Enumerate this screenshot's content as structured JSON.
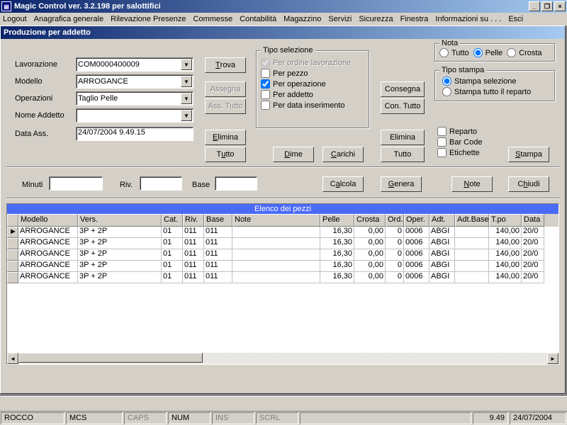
{
  "titlebar": {
    "title": "Magic Control ver. 3.2.198 per salottifici"
  },
  "win_buttons": {
    "min": "_",
    "max": "❐",
    "close": "×"
  },
  "menu": [
    "Logout",
    "Anagrafica generale",
    "Rilevazione Presenze",
    "Commesse",
    "Contabilità",
    "Magazzino",
    "Servizi",
    "Sicurezza",
    "Finestra",
    "Informazioni su . . .",
    "Esci"
  ],
  "child": {
    "title": "Produzione per addetto"
  },
  "labels": {
    "lavorazione": "Lavorazione",
    "modello": "Modello",
    "operazioni": "Operazioni",
    "nome_addetto": "Nome Addetto",
    "data_ass": "Data Ass.",
    "minuti": "Minuti",
    "riv": "Riv.",
    "base": "Base"
  },
  "fields": {
    "lavorazione": "COM0000400009",
    "modello": "ARROGANCE",
    "operazioni": "Taglio Pelle",
    "nome_addetto": "",
    "data_ass": "24/07/2004 9.49.15",
    "minuti": "",
    "riv": "",
    "base": ""
  },
  "buttons": {
    "trova": "Trova",
    "assegna": "Assegna",
    "ass_tutto": "Ass. Tutto",
    "elimina": "Elimina",
    "tutto": "Tutto",
    "dime": "Dime",
    "carichi": "Carichi",
    "consegna": "Consegna",
    "con_tutto": "Con. Tutto",
    "elimina2": "Elimina",
    "tutto2": "Tutto",
    "calcola": "Calcola",
    "genera": "Genera",
    "stampa": "Stampa",
    "note": "Note",
    "chiudi": "Chiudi"
  },
  "tipo_selezione": {
    "legend": "Tipo selezione",
    "items": [
      {
        "label": "Per ordine lavorazione",
        "checked": true,
        "disabled": true
      },
      {
        "label": "Per pezzo",
        "checked": false,
        "disabled": false
      },
      {
        "label": "Per operazione",
        "checked": true,
        "disabled": false
      },
      {
        "label": "Per addetto",
        "checked": false,
        "disabled": false
      },
      {
        "label": "Per data inserimento",
        "checked": false,
        "disabled": false
      }
    ]
  },
  "nota": {
    "legend": "Nota",
    "options": [
      "Tutto",
      "Pelle",
      "Crosta"
    ],
    "selected": "Pelle"
  },
  "tipo_stampa": {
    "legend": "Tipo stampa",
    "options": [
      "Stampa selezione",
      "Stampa tutto il reparto"
    ],
    "selected": "Stampa selezione"
  },
  "stampa_checks": [
    {
      "label": "Reparto",
      "checked": false
    },
    {
      "label": "Bar Code",
      "checked": false
    },
    {
      "label": "Etichette",
      "checked": false
    }
  ],
  "grid": {
    "title": "Elenco dei pezzi",
    "columns": [
      "",
      "Modello",
      "Vers.",
      "Cat.",
      "Riv.",
      "Base",
      "Note",
      "Pelle",
      "Crosta",
      "Ord.",
      "Oper.",
      "Adt.",
      "Adt.Base",
      "T.po",
      "Data"
    ],
    "widths": [
      16,
      84,
      118,
      30,
      30,
      40,
      124,
      48,
      44,
      26,
      36,
      36,
      48,
      46,
      32
    ],
    "rows": [
      {
        "marker": "►",
        "cells": [
          "ARROGANCE",
          "3P + 2P",
          "01",
          "011",
          "011",
          "",
          "16,30",
          "0,00",
          "0",
          "0006",
          "ABGI",
          "",
          "140,00",
          "20/0"
        ]
      },
      {
        "marker": "",
        "cells": [
          "ARROGANCE",
          "3P + 2P",
          "01",
          "011",
          "011",
          "",
          "16,30",
          "0,00",
          "0",
          "0006",
          "ABGI",
          "",
          "140,00",
          "20/0"
        ]
      },
      {
        "marker": "",
        "cells": [
          "ARROGANCE",
          "3P + 2P",
          "01",
          "011",
          "011",
          "",
          "16,30",
          "0,00",
          "0",
          "0006",
          "ABGI",
          "",
          "140,00",
          "20/0"
        ]
      },
      {
        "marker": "",
        "cells": [
          "ARROGANCE",
          "3P + 2P",
          "01",
          "011",
          "011",
          "",
          "16,30",
          "0,00",
          "0",
          "0006",
          "ABGI",
          "",
          "140,00",
          "20/0"
        ]
      },
      {
        "marker": "",
        "cells": [
          "ARROGANCE",
          "3P + 2P",
          "01",
          "011",
          "011",
          "",
          "16,30",
          "0,00",
          "0",
          "0006",
          "ABGI",
          "",
          "140,00",
          "20/0"
        ]
      }
    ]
  },
  "status": {
    "p1": "ROCCO",
    "p2": "MCS",
    "caps": "CAPS",
    "num": "NUM",
    "ins": "INS",
    "scrl": "SCRL",
    "time": "9.49",
    "date": "24/07/2004"
  }
}
